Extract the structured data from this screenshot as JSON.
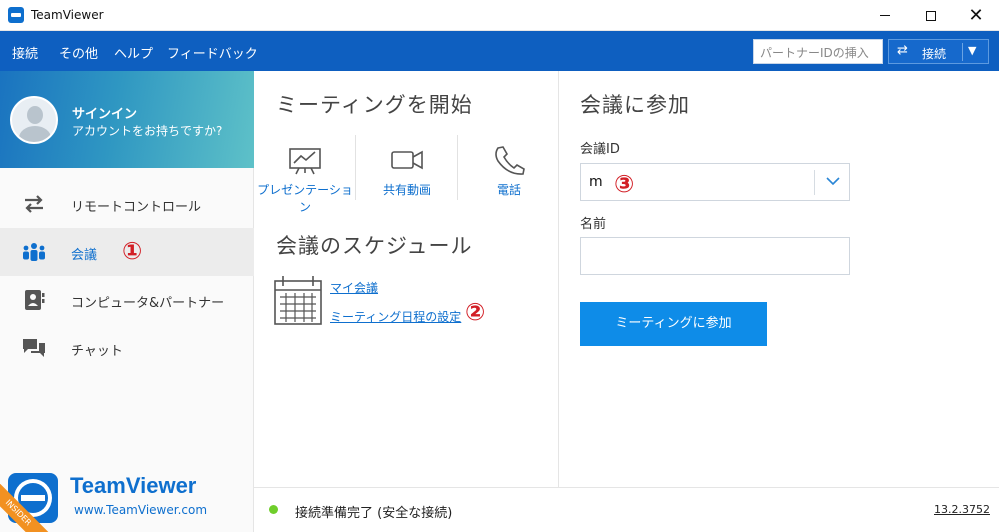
{
  "window": {
    "title": "TeamViewer",
    "controls": {
      "minimize": "minimize-icon",
      "maximize": "maximize-icon",
      "close": "close-icon"
    }
  },
  "menubar": {
    "items": [
      "接続",
      "その他",
      "ヘルプ",
      "フィードバック"
    ],
    "partner_id_placeholder": "パートナーIDの挿入",
    "connect_label": "接続"
  },
  "sidebar": {
    "profile": {
      "signin": "サインイン",
      "account_prompt": "アカウントをお持ちですか?"
    },
    "items": [
      {
        "label": "リモートコントロール",
        "icon": "swap-arrows-icon"
      },
      {
        "label": "会議",
        "icon": "meeting-people-icon",
        "annotation": "①"
      },
      {
        "label": "コンピュータ&パートナー",
        "icon": "contacts-icon"
      },
      {
        "label": "チャット",
        "icon": "chat-icon"
      }
    ],
    "brand": {
      "name": "TeamViewer",
      "url": "www.TeamViewer.com",
      "badge": "INSIDER"
    }
  },
  "start_meeting": {
    "title": "ミーティングを開始",
    "tools": [
      {
        "label": "プレゼンテーション",
        "icon": "presentation-icon"
      },
      {
        "label": "共有動画",
        "icon": "video-camera-icon"
      },
      {
        "label": "電話",
        "icon": "phone-icon"
      }
    ]
  },
  "schedule": {
    "title": "会議のスケジュール",
    "links": [
      "マイ会議",
      "ミーティング日程の設定"
    ],
    "annotation": "②"
  },
  "join_meeting": {
    "title": "会議に参加",
    "meeting_id_label": "会議ID",
    "meeting_id_value": "m",
    "annotation": "③",
    "name_label": "名前",
    "name_value": "",
    "join_button": "ミーティングに参加"
  },
  "status": {
    "text": "接続準備完了 (安全な接続)",
    "version": "13.2.3752",
    "indicator_color": "#6fce2b"
  },
  "colors": {
    "accent": "#0e5fc0",
    "link": "#0e6fce",
    "annotation": "#d21f26",
    "join_button": "#0e8ce8"
  }
}
